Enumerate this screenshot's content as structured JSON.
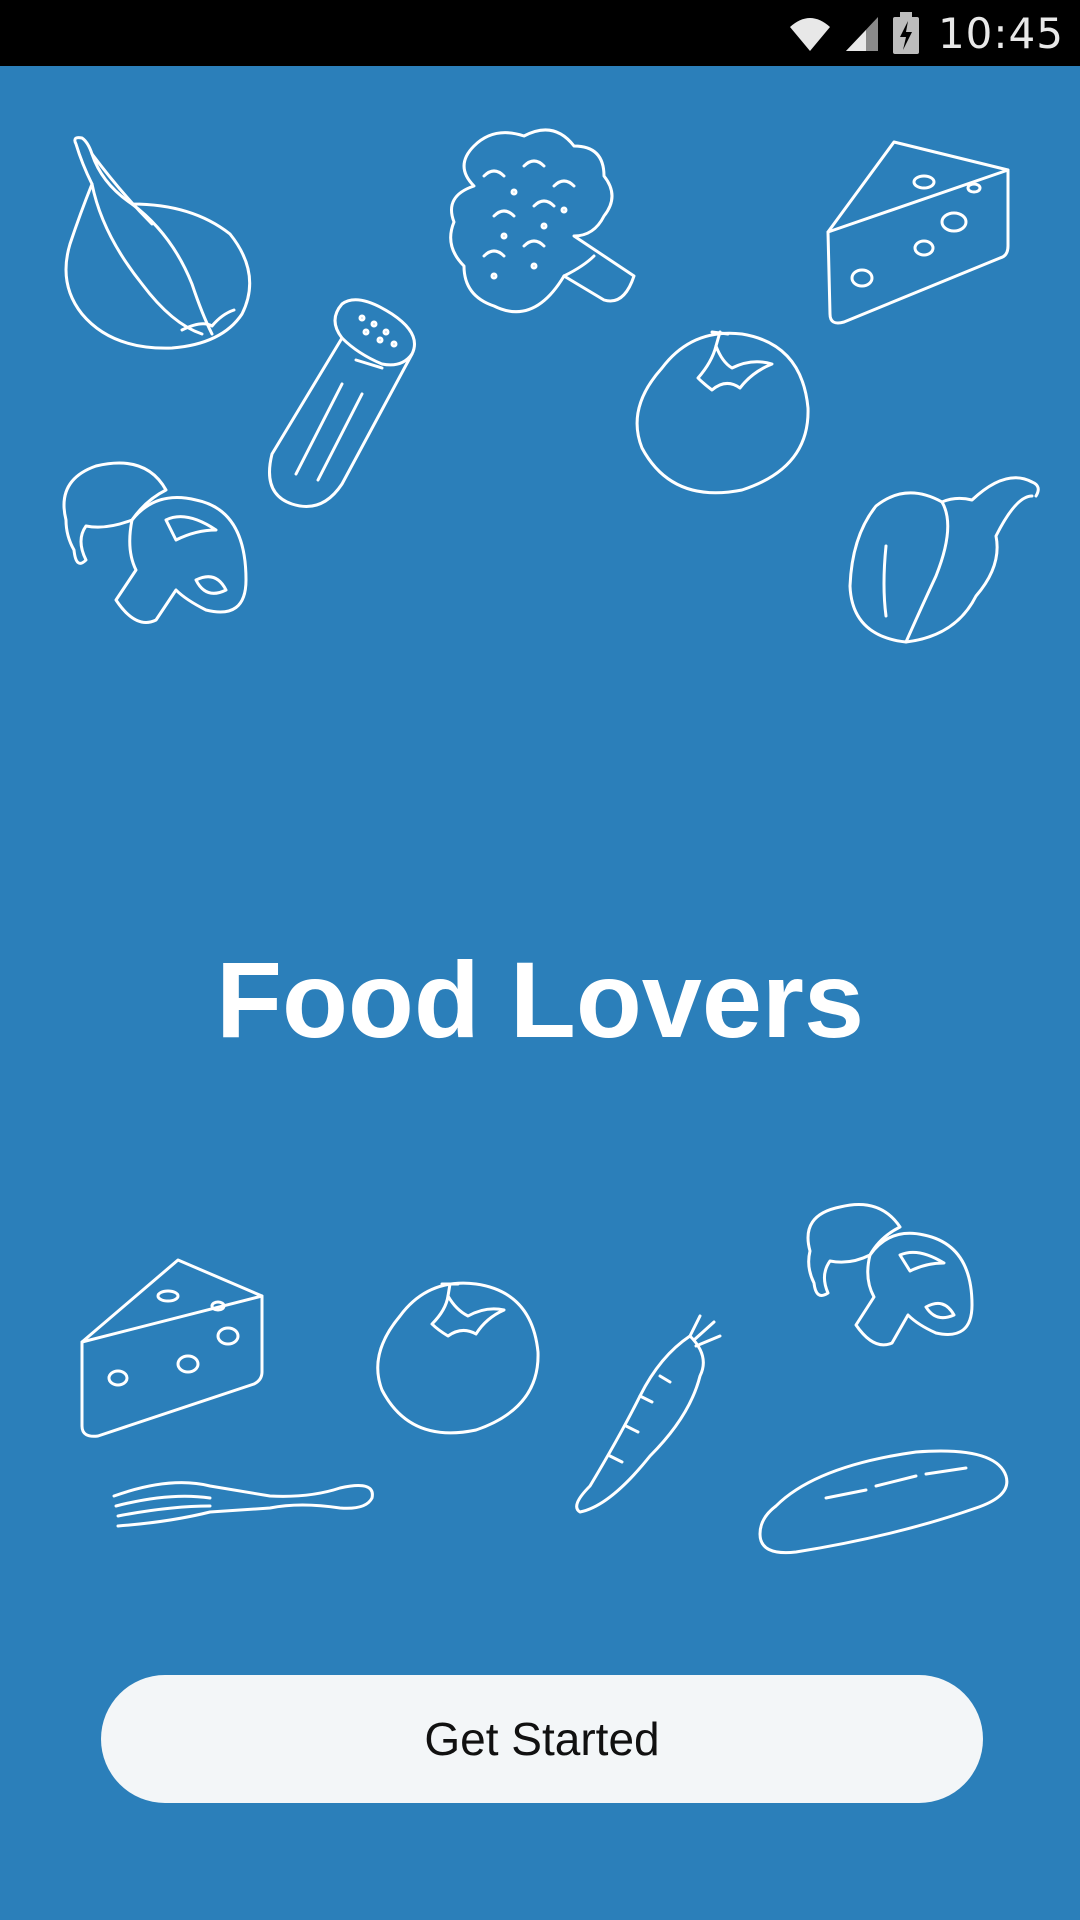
{
  "status_bar": {
    "time": "10:45",
    "icons": [
      "wifi-icon",
      "cell-signal-icon",
      "battery-charging-icon"
    ]
  },
  "app": {
    "title": "Food Lovers",
    "cta_label": "Get Started"
  },
  "illustrations": [
    "garlic-icon",
    "broccoli-icon",
    "cheese-icon",
    "salt-shaker-icon",
    "tomato-icon",
    "mushrooms-icon",
    "bell-pepper-icon",
    "cheese-icon",
    "tomato-icon",
    "carrot-icon",
    "mushrooms-icon",
    "fork-icon",
    "baguette-icon"
  ],
  "colors": {
    "background": "#2b7fba",
    "status_bar": "#000000",
    "button_bg": "#f3f6f8",
    "button_text": "#111111",
    "title": "#ffffff"
  }
}
